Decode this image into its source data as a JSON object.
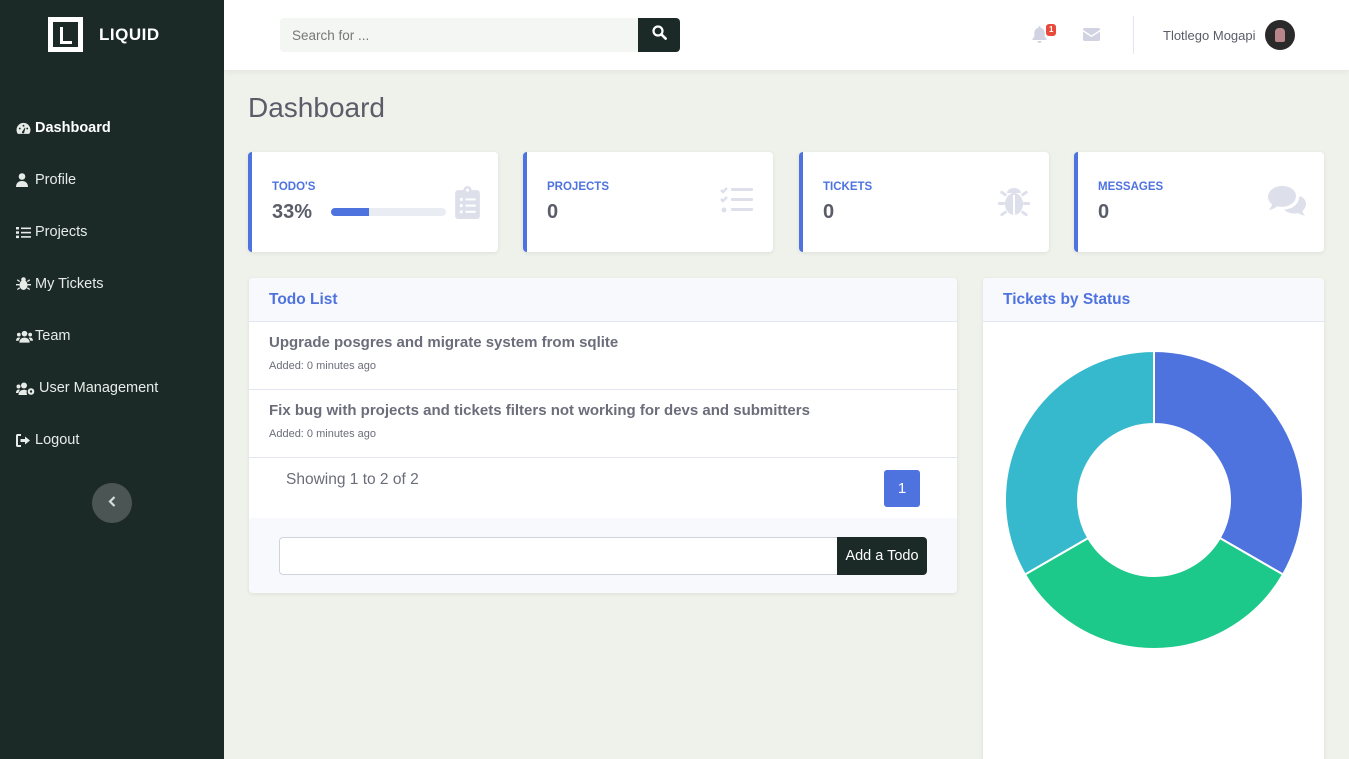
{
  "brand": {
    "name": "LIQUID"
  },
  "sidebar": {
    "items": [
      {
        "label": "Dashboard",
        "icon": "dashboard-icon",
        "active": true
      },
      {
        "label": "Profile",
        "icon": "user-icon"
      },
      {
        "label": "Projects",
        "icon": "tasks-icon"
      },
      {
        "label": "My Tickets",
        "icon": "bug-icon"
      },
      {
        "label": "Team",
        "icon": "users-icon"
      },
      {
        "label": "User Management",
        "icon": "users-cog-icon"
      },
      {
        "label": "Logout",
        "icon": "sign-out-icon"
      }
    ],
    "collapse_icon": "chevron-left-icon"
  },
  "topbar": {
    "search_placeholder": "Search for ...",
    "notifications_count": "1",
    "user_name": "Tlotlego Mogapi"
  },
  "page": {
    "title": "Dashboard"
  },
  "cards": [
    {
      "label": "TODO'S",
      "value": "33%",
      "progress": 0.33,
      "icon": "clipboard-list-icon"
    },
    {
      "label": "PROJECTS",
      "value": "0",
      "icon": "tasks-icon"
    },
    {
      "label": "TICKETS",
      "value": "0",
      "icon": "bug-icon"
    },
    {
      "label": "MESSAGES",
      "value": "0",
      "icon": "comments-icon"
    }
  ],
  "todo": {
    "title": "Todo List",
    "items": [
      {
        "text": "Upgrade posgres and migrate system from sqlite",
        "meta": "Added: 0 minutes ago"
      },
      {
        "text": "Fix bug with projects and tickets filters not working for devs and submitters",
        "meta": "Added: 0 minutes ago"
      }
    ],
    "showing": "Showing 1 to 2 of 2",
    "page": "1",
    "add_button": "Add a Todo",
    "input_value": ""
  },
  "tickets_chart": {
    "title": "Tickets by Status"
  },
  "chart_data": {
    "type": "pie",
    "title": "Tickets by Status",
    "values": [
      1,
      1,
      1
    ],
    "colors": [
      "#4e73df",
      "#1cc88a",
      "#36b9cc"
    ]
  }
}
